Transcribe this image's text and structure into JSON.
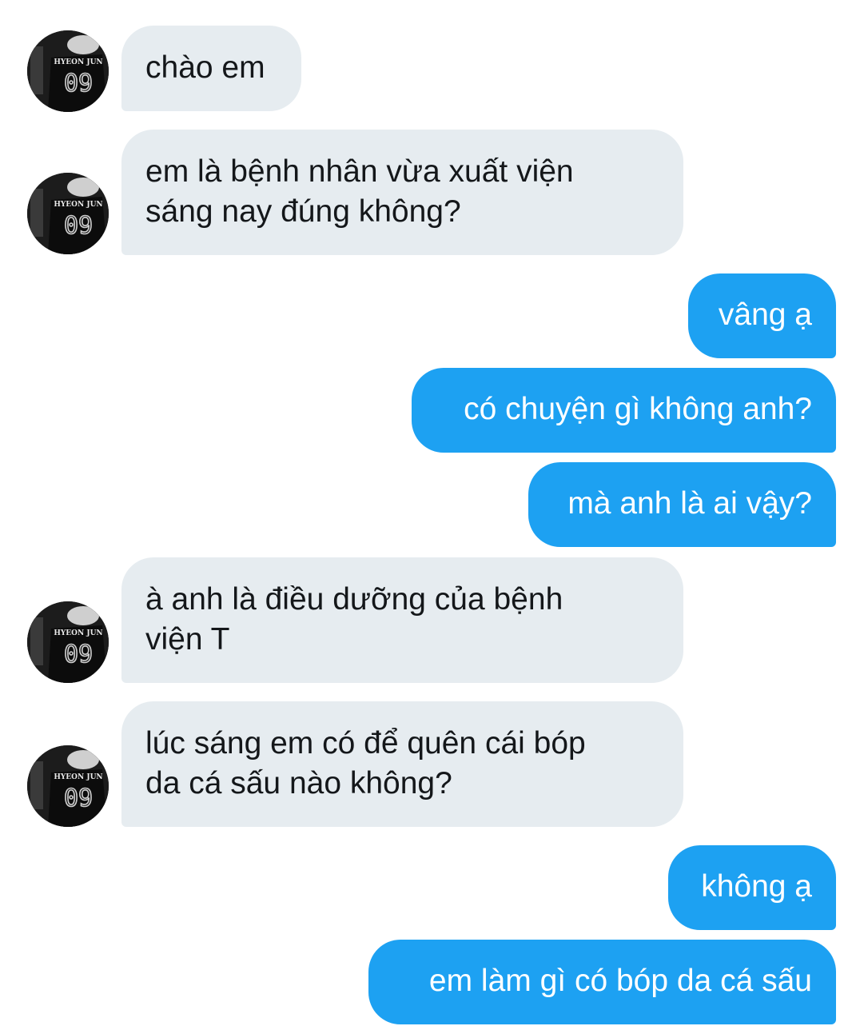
{
  "conversation": {
    "avatar": {
      "jersey_name": "HYEON JUN",
      "jersey_number": "09"
    },
    "messages": [
      {
        "sender": "other",
        "text": "chào em"
      },
      {
        "sender": "other",
        "text": "em là bệnh nhân vừa xuất viện\nsáng nay đúng không?"
      },
      {
        "sender": "me",
        "text": "vâng ạ"
      },
      {
        "sender": "me",
        "text": "có chuyện gì không anh?"
      },
      {
        "sender": "me",
        "text": "mà anh là ai vậy?"
      },
      {
        "sender": "other",
        "text": "à anh là điều dưỡng của bệnh\nviện T"
      },
      {
        "sender": "other",
        "text": "lúc sáng em có để quên cái bóp\nda cá sấu nào không?"
      },
      {
        "sender": "me",
        "text": "không ạ"
      },
      {
        "sender": "me",
        "text": "em làm gì có bóp da cá sấu"
      }
    ]
  },
  "colors": {
    "incoming_bubble": "#e6ecf0",
    "outgoing_bubble": "#1da1f2",
    "text_dark": "#14171a"
  }
}
